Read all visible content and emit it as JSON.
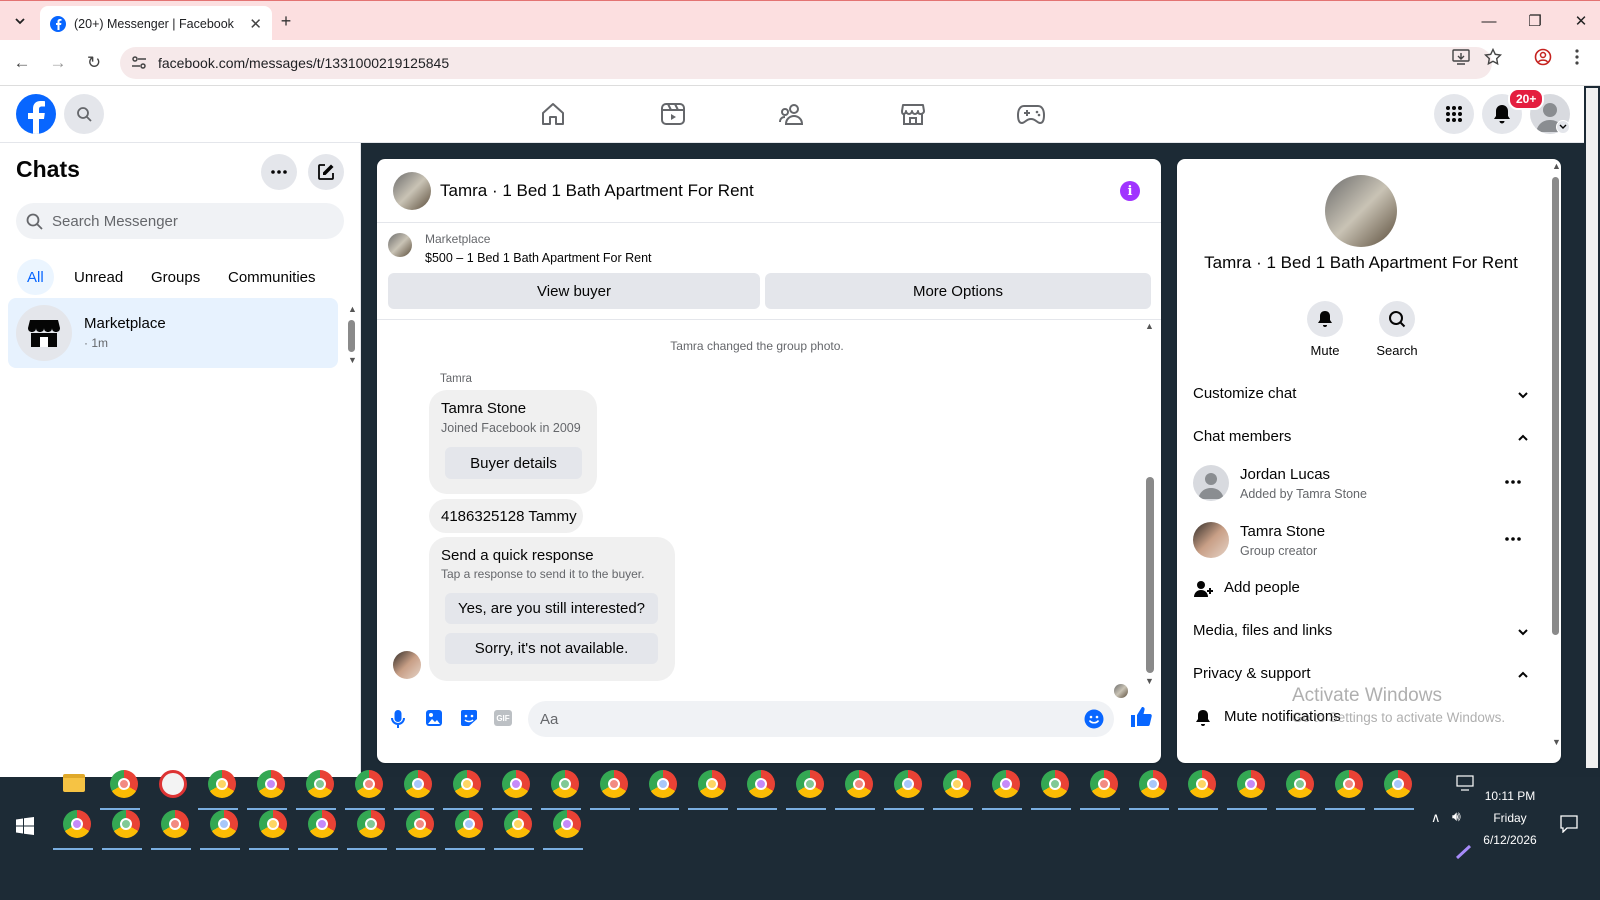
{
  "browser": {
    "tab_title": "(20+) Messenger | Facebook",
    "new_tab": "+",
    "url": "facebook.com/messages/t/1331000219125845"
  },
  "facebook": {
    "notifications_badge": "20+"
  },
  "chats_panel": {
    "title": "Chats",
    "search_placeholder": "Search Messenger",
    "filters": [
      "All",
      "Unread",
      "Groups",
      "Communities"
    ],
    "items": [
      {
        "name": "Marketplace",
        "meta": "· 1m"
      }
    ]
  },
  "conversation": {
    "title": "Tamra · 1 Bed 1 Bath Apartment For Rent",
    "listing_label": "Marketplace",
    "listing_title": "$500 – 1 Bed 1 Bath Apartment For Rent",
    "view_buyer": "View buyer",
    "more_options": "More Options",
    "system_message": "Tamra changed the group photo.",
    "sender_name": "Tamra",
    "profile_card": {
      "name": "Tamra Stone",
      "subtitle": "Joined Facebook in 2009",
      "button": "Buyer details"
    },
    "message": "4186325128 Tammy",
    "quick_response": {
      "title": "Send a quick response",
      "subtitle": "Tap a response to send it to the buyer.",
      "options": [
        "Yes, are you still interested?",
        "Sorry, it's not available."
      ]
    },
    "composer_placeholder": "Aa"
  },
  "info_panel": {
    "title": "Tamra · 1 Bed 1 Bath Apartment For Rent",
    "actions": [
      "Mute",
      "Search"
    ],
    "sections": {
      "customize": "Customize chat",
      "members": "Chat members",
      "media": "Media, files and links",
      "privacy": "Privacy & support"
    },
    "members": [
      {
        "name": "Jordan Lucas",
        "role": "Added by Tamra Stone"
      },
      {
        "name": "Tamra Stone",
        "role": "Group creator"
      }
    ],
    "add_people": "Add people",
    "mute_notifications": "Mute notifications",
    "watermark_title": "Activate Windows",
    "watermark_sub": "Go to Settings to activate Windows."
  },
  "taskbar": {
    "time": "10:11 PM",
    "day": "Friday",
    "date": "6/12/2026"
  },
  "colors": {
    "facebook_blue": "#0866ff",
    "messenger_purple": "#a033ff",
    "chrome_tab_bg": "#fcdfe0",
    "notification_red": "#e41e3f"
  }
}
